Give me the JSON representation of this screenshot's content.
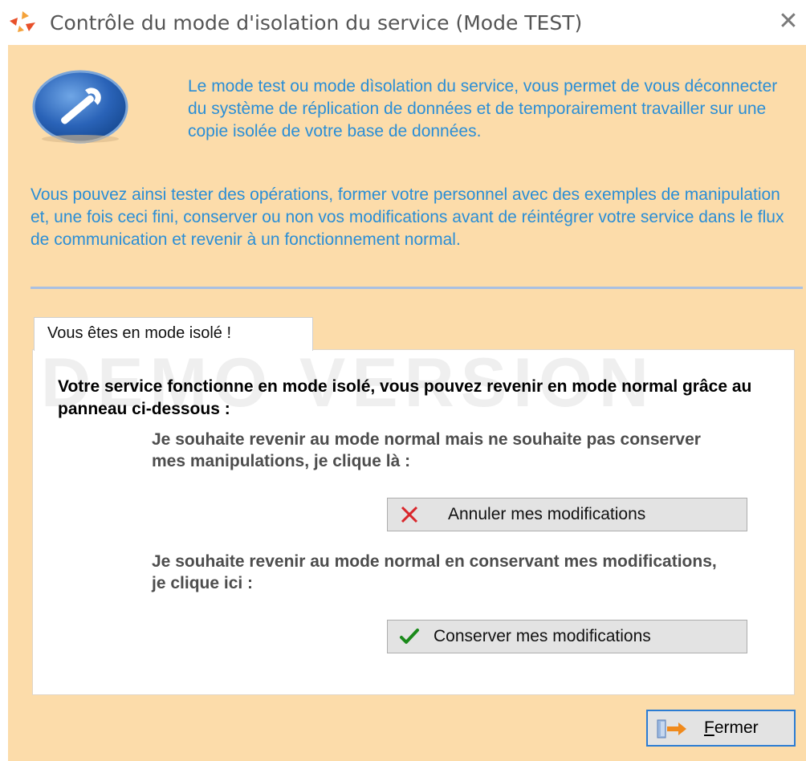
{
  "window": {
    "title": "Contrôle du mode d'isolation du service (Mode TEST)",
    "close_glyph": "✕"
  },
  "intro": {
    "paragraph1": "Le mode test ou mode dìsolation du service, vous permet de vous déconnecter du système de réplication de données et de temporairement travailler sur une copie isolée de votre base de données.",
    "paragraph2": "Vous pouvez ainsi tester des opérations, former votre personnel avec des exemples de manipulation et, une fois ceci fini, conserver ou non vos modifications avant de réintégrer votre service dans le flux de communication et revenir à un fonctionnement normal."
  },
  "tab": {
    "label": "Vous êtes en mode isolé !"
  },
  "panel": {
    "watermark": "DEMO VERSION",
    "heading": "Votre service fonctionne en mode isolé, vous pouvez revenir en mode normal grâce au panneau ci-dessous :",
    "prompt_cancel": "Je souhaite revenir au mode normal mais ne souhaite pas conserver mes manipulations, je clique là :",
    "cancel_button": "Annuler mes modifications",
    "prompt_keep": "Je souhaite revenir au mode normal en conservant mes modifications, je clique ici :",
    "keep_button": "Conserver mes modifications"
  },
  "footer": {
    "close_button_first": "F",
    "close_button_rest": "ermer"
  },
  "icons": {
    "app": "app-logo-icon",
    "wrench": "wrench-icon",
    "cancel": "red-x-icon",
    "keep": "green-check-icon",
    "exit": "exit-door-icon"
  },
  "colors": {
    "dialog_background": "#fcdcaa",
    "intro_text": "#2a8ed6",
    "cancel_icon": "#d9262b",
    "keep_icon": "#1b8a1b",
    "focus_border": "#2b7cd3"
  }
}
